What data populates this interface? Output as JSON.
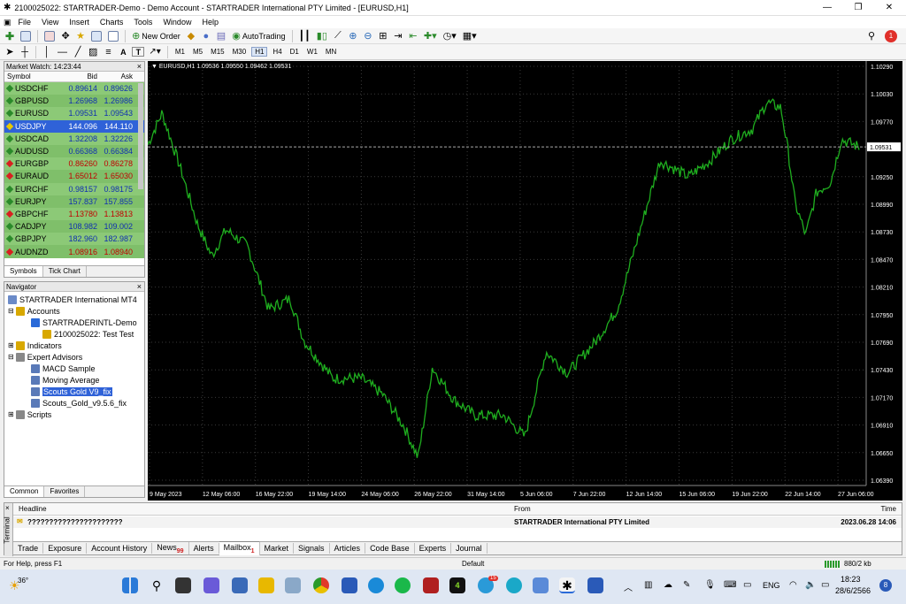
{
  "window": {
    "title": "2100025022: STARTRADER-Demo - Demo Account - STARTRADER International PTY Limited - [EURUSD,H1]",
    "min": "—",
    "max": "❐",
    "close": "✕"
  },
  "menu": [
    "File",
    "View",
    "Insert",
    "Charts",
    "Tools",
    "Window",
    "Help"
  ],
  "toolbar": {
    "new_order": "New Order",
    "autotrading": "AutoTrading"
  },
  "timeframes": [
    "M1",
    "M5",
    "M15",
    "M30",
    "H1",
    "H4",
    "D1",
    "W1",
    "MN"
  ],
  "drawing_text_tool": "A",
  "drawing_label_tool": "T",
  "market_watch": {
    "title": "Market Watch: 14:23:44",
    "cols": {
      "symbol": "Symbol",
      "bid": "Bid",
      "ask": "Ask"
    },
    "rows": [
      {
        "symbol": "USDCHF",
        "bid": "0.89614",
        "ask": "0.89626",
        "dir": "up"
      },
      {
        "symbol": "GBPUSD",
        "bid": "1.26968",
        "ask": "1.26986",
        "dir": "up"
      },
      {
        "symbol": "EURUSD",
        "bid": "1.09531",
        "ask": "1.09543",
        "dir": "up"
      },
      {
        "symbol": "USDJPY",
        "bid": "144.096",
        "ask": "144.110",
        "dir": "sel"
      },
      {
        "symbol": "USDCAD",
        "bid": "1.32208",
        "ask": "1.32226",
        "dir": "up"
      },
      {
        "symbol": "AUDUSD",
        "bid": "0.66368",
        "ask": "0.66384",
        "dir": "up"
      },
      {
        "symbol": "EURGBP",
        "bid": "0.86260",
        "ask": "0.86278",
        "dir": "down"
      },
      {
        "symbol": "EURAUD",
        "bid": "1.65012",
        "ask": "1.65030",
        "dir": "down"
      },
      {
        "symbol": "EURCHF",
        "bid": "0.98157",
        "ask": "0.98175",
        "dir": "up"
      },
      {
        "symbol": "EURJPY",
        "bid": "157.837",
        "ask": "157.855",
        "dir": "up"
      },
      {
        "symbol": "GBPCHF",
        "bid": "1.13780",
        "ask": "1.13813",
        "dir": "down"
      },
      {
        "symbol": "CADJPY",
        "bid": "108.982",
        "ask": "109.002",
        "dir": "up"
      },
      {
        "symbol": "GBPJPY",
        "bid": "182.960",
        "ask": "182.987",
        "dir": "up"
      },
      {
        "symbol": "AUDNZD",
        "bid": "1.08916",
        "ask": "1.08940",
        "dir": "down"
      }
    ],
    "tabs": [
      "Symbols",
      "Tick Chart"
    ]
  },
  "navigator": {
    "title": "Navigator",
    "items": [
      {
        "label": "STARTRADER International MT4",
        "level": 0,
        "icon": "terminal-icon"
      },
      {
        "label": "Accounts",
        "level": 1,
        "icon": "accounts-icon"
      },
      {
        "label": "STARTRADERINTL-Demo",
        "level": 2,
        "icon": "server-icon"
      },
      {
        "label": "2100025022: Test Test",
        "level": 3,
        "icon": "user-icon"
      },
      {
        "label": "Indicators",
        "level": 1,
        "icon": "indicators-icon"
      },
      {
        "label": "Expert Advisors",
        "level": 1,
        "icon": "experts-icon"
      },
      {
        "label": "MACD Sample",
        "level": 2,
        "icon": "ea-icon"
      },
      {
        "label": "Moving Average",
        "level": 2,
        "icon": "ea-icon"
      },
      {
        "label": "Scouts Gold V9_fix",
        "level": 2,
        "icon": "ea-icon",
        "selected": true
      },
      {
        "label": "Scouts_Gold_v9.5.6_fix",
        "level": 2,
        "icon": "ea-icon"
      },
      {
        "label": "Scripts",
        "level": 1,
        "icon": "scripts-icon"
      }
    ],
    "tabs": [
      "Common",
      "Favorites"
    ]
  },
  "chart": {
    "info": "EURUSD,H1  1.09536 1.09550 1.09462 1.09531",
    "current_price": "1.09531",
    "price_labels": [
      "1.10290",
      "1.10030",
      "1.09770",
      "1.09531",
      "1.09250",
      "1.08990",
      "1.08730",
      "1.08470",
      "1.08210",
      "1.07950",
      "1.07690",
      "1.07430",
      "1.07170",
      "1.06910",
      "1.06650",
      "1.06390"
    ],
    "time_labels": [
      "9 May 2023",
      "12 May 06:00",
      "16 May 22:00",
      "19 May 14:00",
      "24 May 06:00",
      "26 May 22:00",
      "31 May 14:00",
      "5 Jun 06:00",
      "7 Jun 22:00",
      "12 Jun 14:00",
      "15 Jun 06:00",
      "19 Jun 22:00",
      "22 Jun 14:00",
      "27 Jun 06:00"
    ],
    "colors": {
      "bg": "#000000",
      "line": "#1fae1f",
      "grid": "#3a3a3a",
      "text": "#ffffff"
    }
  },
  "terminal": {
    "label": "Terminal",
    "headers": {
      "headline": "Headline",
      "from": "From",
      "time": "Time"
    },
    "row": {
      "headline": "??????????????????????",
      "from": "STARTRADER International PTY Limited",
      "time": "2023.06.28 14:06"
    },
    "tabs": [
      {
        "label": "Trade"
      },
      {
        "label": "Exposure"
      },
      {
        "label": "Account History"
      },
      {
        "label": "News",
        "badge": "99"
      },
      {
        "label": "Alerts"
      },
      {
        "label": "Mailbox",
        "badge": "1",
        "active": true
      },
      {
        "label": "Market"
      },
      {
        "label": "Signals"
      },
      {
        "label": "Articles"
      },
      {
        "label": "Code Base"
      },
      {
        "label": "Experts"
      },
      {
        "label": "Journal"
      }
    ]
  },
  "status": {
    "help": "For Help, press F1",
    "profile": "Default",
    "traffic": "880/2 kb"
  },
  "taskbar": {
    "weather": "36°",
    "lang": "ENG",
    "time": "18:23",
    "date": "28/6/2566",
    "notif_badge": "8",
    "telegram_badge": "15"
  }
}
